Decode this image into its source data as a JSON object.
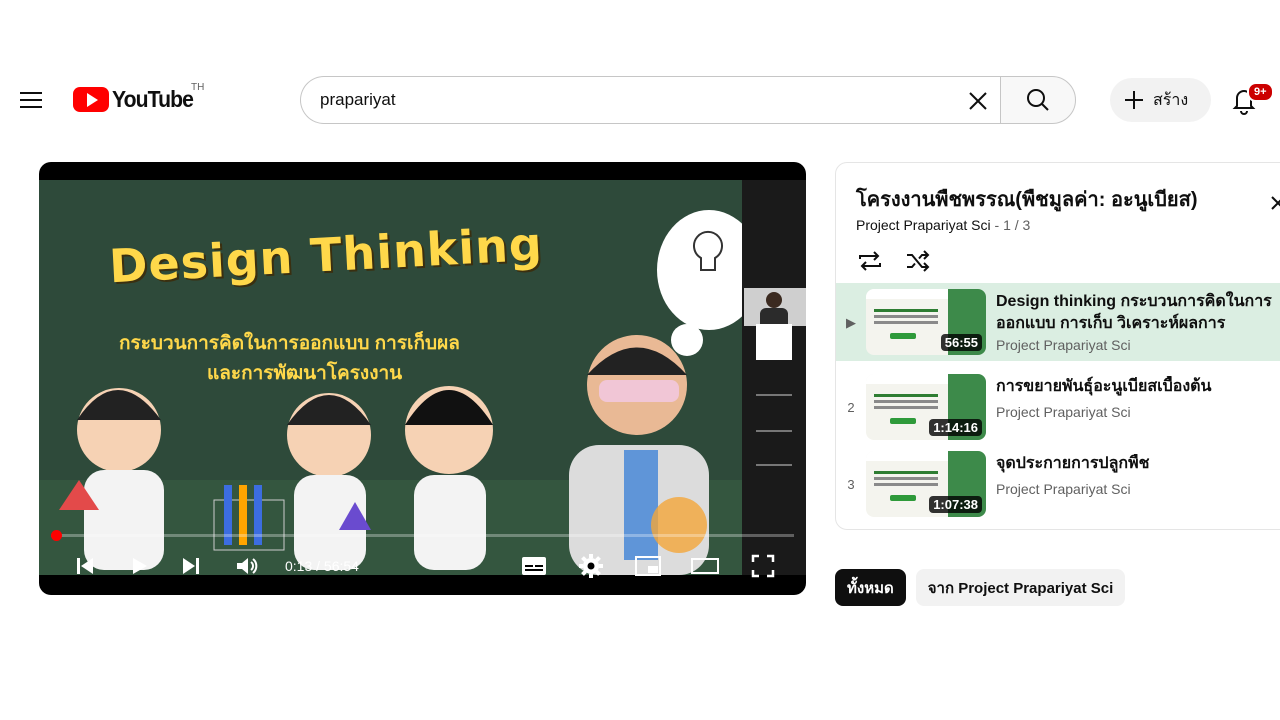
{
  "header": {
    "logo_text": "YouTube",
    "country_code": "TH",
    "search_value": "prapariyat",
    "create_label": "สร้าง",
    "notification_count": "9+"
  },
  "player": {
    "slide": {
      "title": "Design Thinking",
      "subtitle_line1": "กระบวนการคิดในการออกแบบ การเก็บผล",
      "subtitle_line2": "และการพัฒนาโครงงาน"
    },
    "current_time": "0:13",
    "time_separator": "/",
    "total_time": "56:54",
    "progress": 0.004
  },
  "playlist": {
    "title": "โครงงานพืชพรรณ(พืชมูลค่า: อะนูเบียส)",
    "channel": "Project Prapariyat Sci",
    "position": "1 / 3",
    "items": [
      {
        "index": "▶",
        "title": "Design thinking กระบวนการคิดในการออกแบบ การเก็บ วิเคราะห์ผลการทดลอง...",
        "channel": "Project Prapariyat Sci",
        "duration": "56:55",
        "active": true
      },
      {
        "index": "2",
        "title": "การขยายพันธุ์อะนูเบียสเบื้องต้น",
        "channel": "Project Prapariyat Sci",
        "duration": "1:14:16",
        "active": false
      },
      {
        "index": "3",
        "title": "จุดประกายการปลูกพืช",
        "channel": "Project Prapariyat Sci",
        "duration": "1:07:38",
        "active": false
      }
    ]
  },
  "chips": {
    "all": "ทั้งหมด",
    "from_channel": "จาก Project Prapariyat Sci"
  },
  "colors": {
    "brand_red": "#ff0000",
    "active_row": "#dbeee2",
    "chalkboard": "#2e4a3a",
    "slide_text": "#ffd84a"
  },
  "icons": [
    "menu-icon",
    "youtube-logo-icon",
    "clear-icon",
    "search-icon",
    "plus-icon",
    "bell-icon",
    "repeat-icon",
    "shuffle-icon",
    "close-icon",
    "previous-icon",
    "play-icon",
    "next-icon",
    "volume-icon",
    "subtitles-icon",
    "settings-icon",
    "miniplayer-icon",
    "theater-icon",
    "fullscreen-icon"
  ]
}
